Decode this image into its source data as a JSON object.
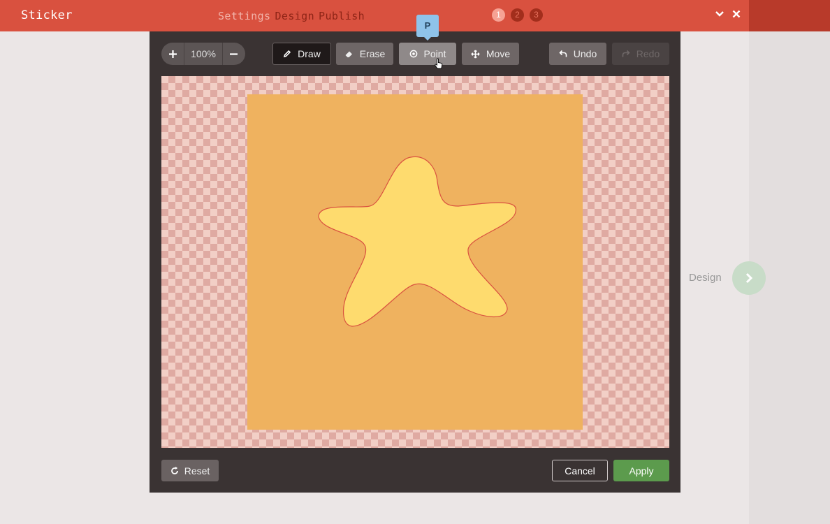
{
  "app": {
    "title": "Sticker"
  },
  "nav": {
    "steps": [
      "Settings",
      "Design",
      "Publish"
    ],
    "step_numbers": [
      "1",
      "2",
      "3"
    ],
    "active_step": 1
  },
  "header_icons": {
    "collapse": "chevron-down-icon",
    "close": "close-icon"
  },
  "toolbar": {
    "zoom": {
      "value": "100%",
      "in_icon": "plus-icon",
      "out_icon": "minus-icon"
    },
    "tools": [
      {
        "label": "Draw",
        "icon": "pencil-icon",
        "state": "selected"
      },
      {
        "label": "Erase",
        "icon": "eraser-icon",
        "state": "normal"
      },
      {
        "label": "Point",
        "icon": "target-icon",
        "state": "hover"
      },
      {
        "label": "Move",
        "icon": "move-icon",
        "state": "normal"
      }
    ],
    "history": [
      {
        "label": "Undo",
        "icon": "undo-icon",
        "enabled": true
      },
      {
        "label": "Redo",
        "icon": "redo-icon",
        "enabled": false
      }
    ],
    "tooltip": "P"
  },
  "canvas": {
    "background_color": "#efb25f",
    "shape_fill": "#fedb6e",
    "shape_stroke": "#d9513f",
    "shape": "star"
  },
  "footer": {
    "reset_label": "Reset",
    "cancel_label": "Cancel",
    "apply_label": "Apply"
  },
  "side_next": {
    "label": "Design",
    "icon": "chevron-right-icon"
  },
  "colors": {
    "brand": "#d9513f",
    "apply": "#5c9b4d",
    "tooltip": "#8fc3ea"
  }
}
